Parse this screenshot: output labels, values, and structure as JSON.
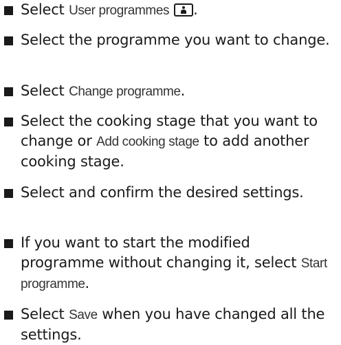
{
  "steps": [
    {
      "before": "Select ",
      "ui": "User programmes",
      "icon": "user-key-icon",
      "after": "."
    },
    {
      "text": "Select the programme you want to change."
    },
    {
      "before": "Select ",
      "ui": "Change programme",
      "after": "."
    },
    {
      "before": "Select the cooking stage that you want to change or ",
      "ui": "Add cooking stage",
      "after": " to add another cooking stage."
    },
    {
      "text": "Select and confirm the desired settings."
    },
    {
      "before": "If you want to start the modified programme without changing it, select ",
      "ui": "Start programme",
      "after": "."
    },
    {
      "before": "Select ",
      "ui": "Save",
      "after": " when you have changed all the settings."
    }
  ]
}
